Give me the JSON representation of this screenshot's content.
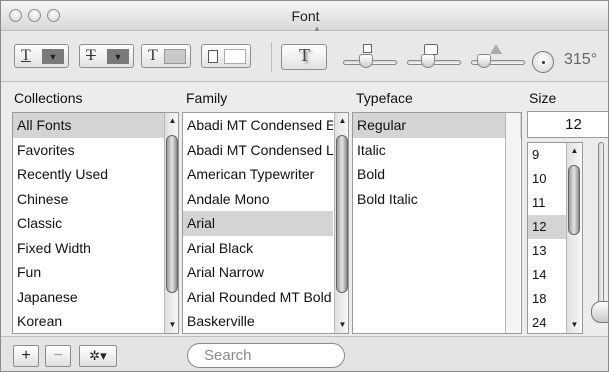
{
  "window": {
    "title": "Font"
  },
  "toolbar": {
    "underline_glyph": "T",
    "strikethrough_glyph": "T",
    "text_color_glyph": "T",
    "shadow_glyph": "T",
    "angle_value": "315°",
    "icons": [
      "underline-icon",
      "strikethrough-icon",
      "text-color-icon",
      "document-color-icon",
      "text-shadow-icon",
      "shadow-opacity-icon",
      "shadow-blur-icon",
      "shadow-offset-icon",
      "shadow-angle-icon"
    ]
  },
  "headers": {
    "collections": "Collections",
    "family": "Family",
    "typeface": "Typeface",
    "size": "Size"
  },
  "collections": {
    "items": [
      "All Fonts",
      "Favorites",
      "Recently Used",
      "Chinese",
      "Classic",
      "Fixed Width",
      "Fun",
      "Japanese",
      "Korean"
    ],
    "selected": "All Fonts"
  },
  "family": {
    "items": [
      "Abadi MT Condensed Extra Bold",
      "Abadi MT Condensed Light",
      "American Typewriter",
      "Andale Mono",
      "Arial",
      "Arial Black",
      "Arial Narrow",
      "Arial Rounded MT Bold",
      "Baskerville"
    ],
    "selected": "Arial"
  },
  "typeface": {
    "items": [
      "Regular",
      "Italic",
      "Bold",
      "Bold Italic"
    ],
    "selected": "Regular"
  },
  "size": {
    "value": "12",
    "items": [
      "9",
      "10",
      "11",
      "12",
      "13",
      "14",
      "18",
      "24"
    ],
    "selected": "12"
  },
  "bottom": {
    "add_label": "+",
    "remove_label": "−",
    "action_label": "✲▾",
    "search_placeholder": "Search"
  },
  "colors": {
    "selection": "#d4d4d4",
    "text_color_swatch": "#707070",
    "doc_color_swatch": "#ffffff"
  }
}
